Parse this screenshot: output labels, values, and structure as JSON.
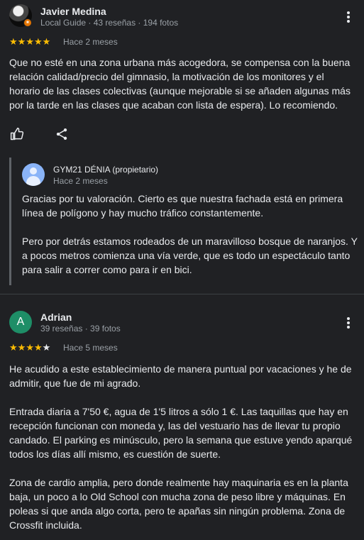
{
  "reviews": [
    {
      "name": "Javier Medina",
      "meta": "Local Guide · 43 reseñas · 194 fotos",
      "rating": 5,
      "date": "Hace 2 meses",
      "text": "Que no esté en una zona urbana más acogedora, se compensa con la buena relación calidad/precio del gimnasio, la motivación de los monitores y el horario de las clases colectivas (aunque mejorable si se añaden algunas más por la tarde en las clases que acaban con lista de espera). Lo recomiendo.",
      "reply": {
        "owner": "GYM21 DÉNIA (propietario)",
        "date": "Hace 2 meses",
        "paragraphs": [
          "Gracias por tu valoración. Cierto es que nuestra fachada está en primera línea de polígono y hay mucho tráfico constantemente.",
          "Pero por detrás estamos rodeados de un maravilloso bosque de naranjos. Y a pocos metros comienza una vía verde, que es todo un espectáculo tanto para salir a correr como para ir en bici."
        ]
      }
    },
    {
      "name": "Adrian",
      "avatar_letter": "A",
      "meta": "39 reseñas · 39 fotos",
      "rating": 4,
      "date": "Hace 5 meses",
      "paragraphs": [
        "He acudido a este establecimiento de manera puntual por vacaciones y he de admitir, que fue de mi agrado.",
        "Entrada diaria a 7'50 €, agua de 1'5 litros a sólo 1 €. Las taquillas que hay en recepción funcionan con moneda y, las del vestuario has de llevar tu propio candado. El parking es minúsculo, pero la semana que estuve yendo aparqué todos los días allí mismo, es cuestión de suerte.",
        "Zona de cardio amplia, pero donde realmente hay maquinaria es en la planta baja, un poco a lo Old School con mucha zona de peso libre y máquinas. En poleas si que anda algo corta, pero te apañas sin ningún problema. Zona de Crossfit incluida."
      ]
    }
  ],
  "colors": {
    "star": "#fbbc04",
    "avatar_green": "#1e8e67",
    "owner_avatar": "#8ab4f8",
    "local_guide_badge": "#e37400"
  },
  "icons": [
    "user-photo",
    "local-guide-badge",
    "more-vert-icon",
    "thumb-up-icon",
    "share-icon",
    "owner-avatar-icon"
  ]
}
